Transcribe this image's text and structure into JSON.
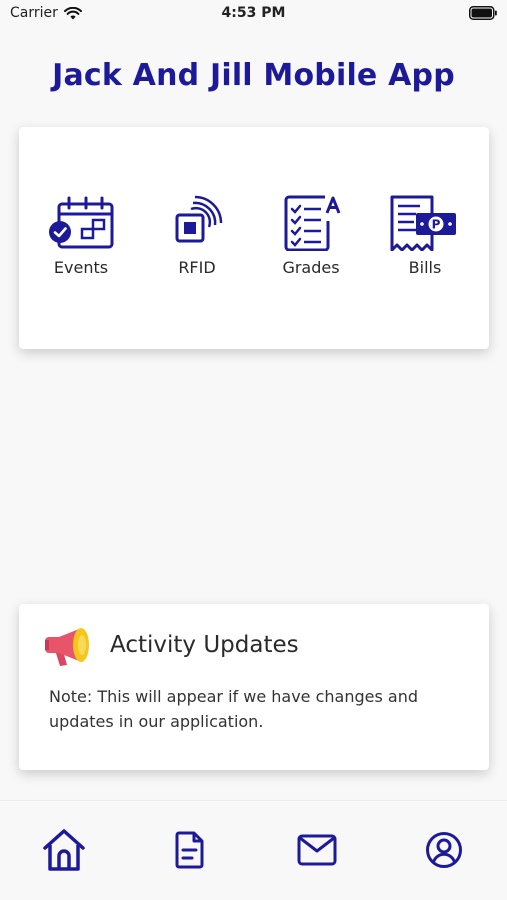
{
  "status_bar": {
    "carrier": "Carrier",
    "time": "4:53 PM"
  },
  "header": {
    "title": "Jack And Jill Mobile App"
  },
  "menu": {
    "items": [
      {
        "label": "Events",
        "icon": "calendar-icon"
      },
      {
        "label": "RFID",
        "icon": "rfid-icon"
      },
      {
        "label": "Grades",
        "icon": "grades-icon"
      },
      {
        "label": "Bills",
        "icon": "bills-icon"
      }
    ]
  },
  "activity": {
    "title": "Activity Updates",
    "note": "Note: This will appear if we have changes and updates in our application.",
    "icon": "megaphone-icon"
  },
  "bottom_nav": {
    "items": [
      {
        "icon": "home-icon"
      },
      {
        "icon": "document-icon"
      },
      {
        "icon": "mail-icon"
      },
      {
        "icon": "profile-icon"
      }
    ]
  },
  "colors": {
    "brand": "#1d1a9a",
    "accent": "#f6c61b",
    "megaphone_body": "#e8546a"
  }
}
